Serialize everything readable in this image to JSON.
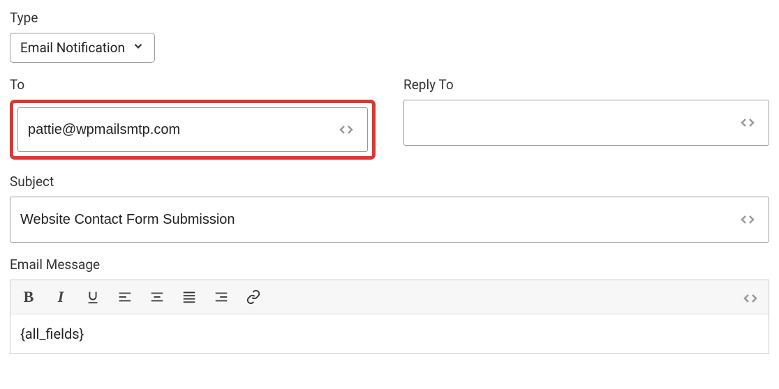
{
  "type": {
    "label": "Type",
    "selected": "Email Notification"
  },
  "to": {
    "label": "To",
    "value": "pattie@wpmailsmtp.com"
  },
  "reply_to": {
    "label": "Reply To",
    "value": ""
  },
  "subject": {
    "label": "Subject",
    "value": "Website Contact Form Submission"
  },
  "email_message": {
    "label": "Email Message",
    "body": "{all_fields}"
  },
  "toolbar": {
    "bold": "B",
    "italic": "I"
  }
}
